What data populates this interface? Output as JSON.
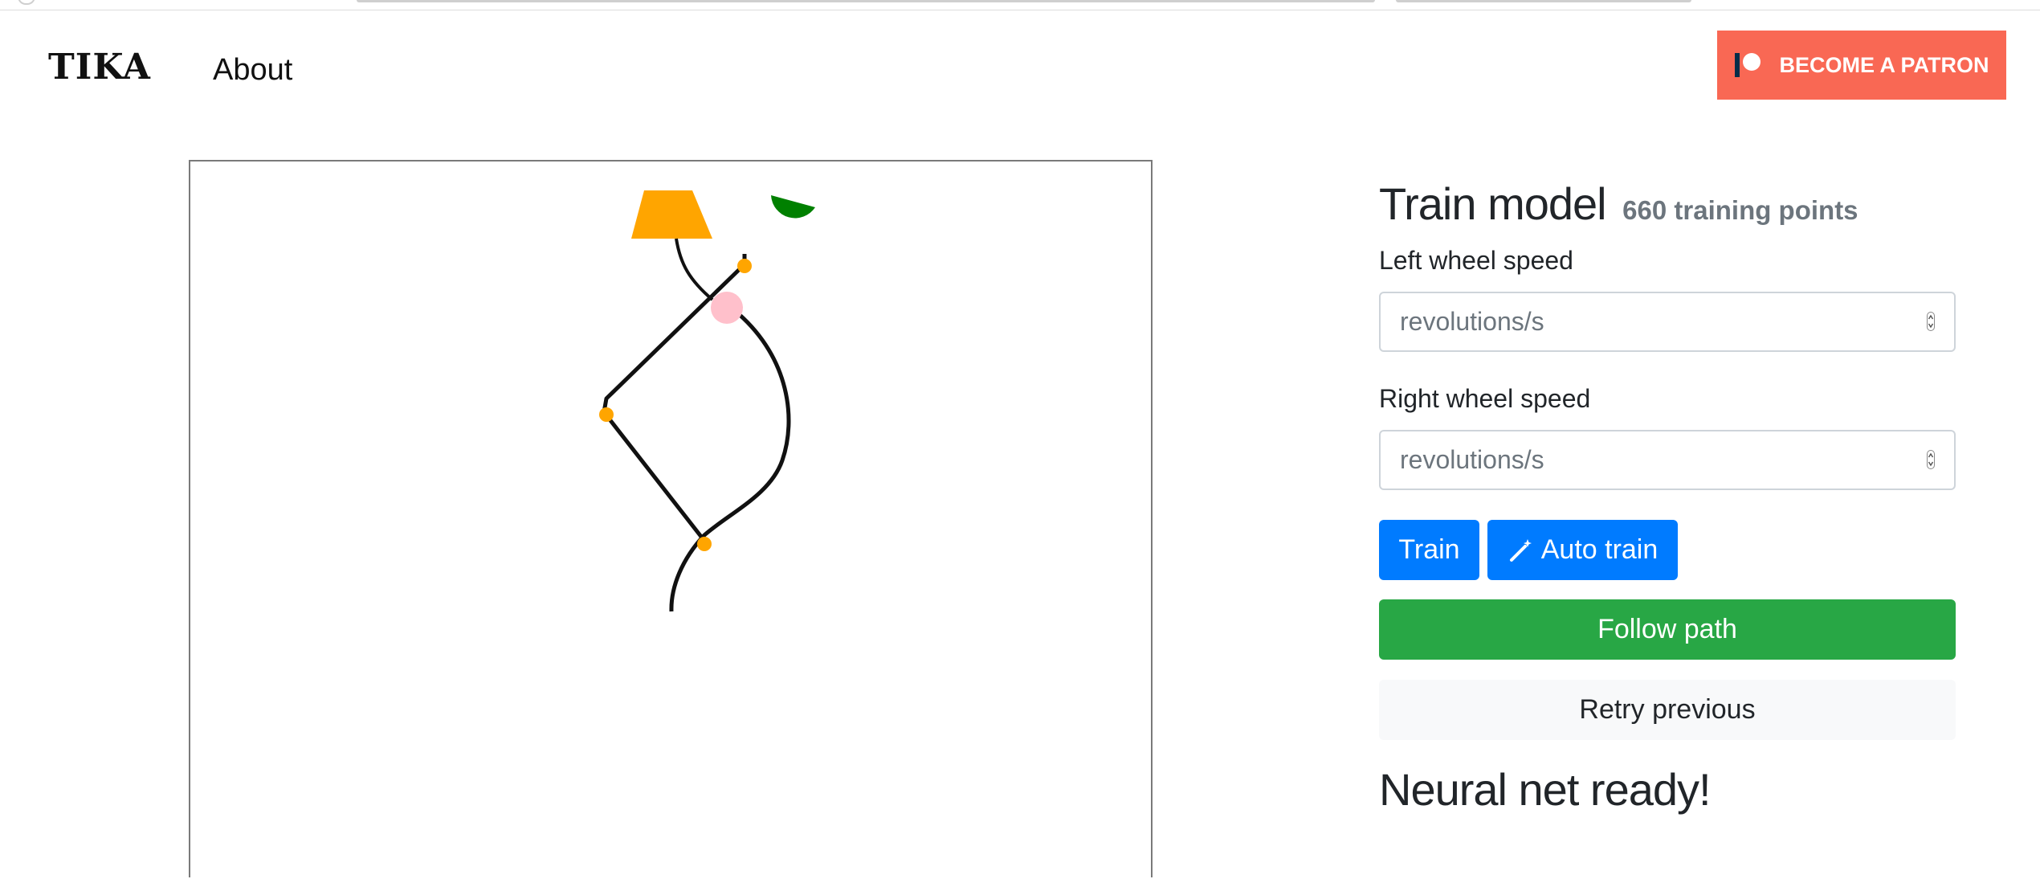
{
  "header": {
    "brand": "TIKA",
    "nav_about": "About",
    "patron_button": "BECOME A PATRON",
    "patron_color": "#f96854"
  },
  "panel": {
    "title": "Train model",
    "training_points": "660 training points",
    "left_label": "Left wheel speed",
    "left_placeholder": "revolutions/s",
    "left_value": "",
    "right_label": "Right wheel speed",
    "right_placeholder": "revolutions/s",
    "right_value": "",
    "train_label": "Train",
    "auto_train_label": "Auto train",
    "auto_train_icon": "magic-wand-icon",
    "follow_path_label": "Follow path",
    "retry_label": "Retry previous",
    "status_text": "Neural net ready!"
  },
  "colors": {
    "primary": "#007bff",
    "success": "#28a745",
    "light": "#f8f9fa",
    "target_shape": "#ffa500",
    "robot": "#008000",
    "robot_marker": "#ffc0cb",
    "waypoint": "#ffa500"
  }
}
